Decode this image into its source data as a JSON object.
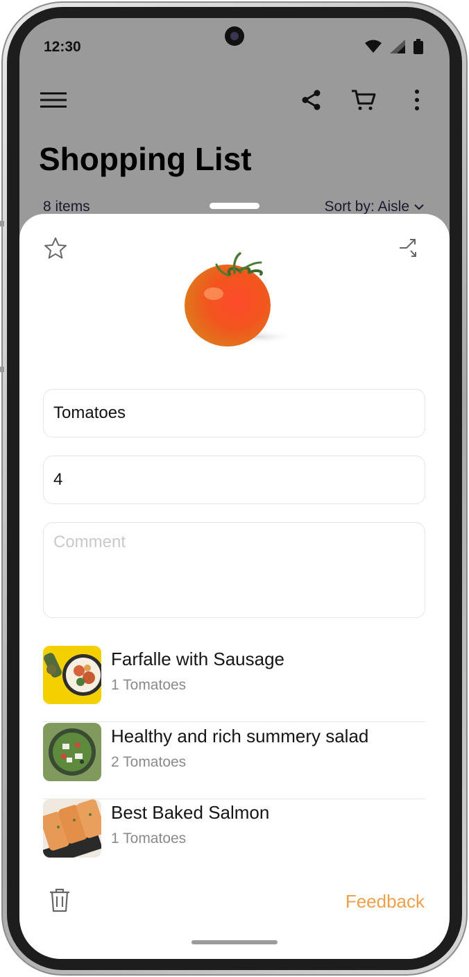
{
  "status_bar": {
    "time": "12:30"
  },
  "app_bar": {
    "menu_icon": "hamburger-menu-icon",
    "share_icon": "share-icon",
    "cart_icon": "cart-icon",
    "more_icon": "more-vert-icon"
  },
  "header": {
    "title": "Shopping List",
    "item_count": "8 items",
    "sort_label": "Sort by: Aisle"
  },
  "item_sheet": {
    "name_value": "Tomatoes",
    "quantity_value": "4",
    "comment_placeholder": "Comment",
    "recipes": [
      {
        "title": "Farfalle with Sausage",
        "subtitle": "1 Tomatoes"
      },
      {
        "title": "Healthy and rich summery salad",
        "subtitle": "2 Tomatoes"
      },
      {
        "title": "Best Baked Salmon",
        "subtitle": "1 Tomatoes"
      }
    ],
    "feedback_label": "Feedback"
  },
  "colors": {
    "accent": "#f0a04b",
    "scrim": "#9a9a9a"
  }
}
